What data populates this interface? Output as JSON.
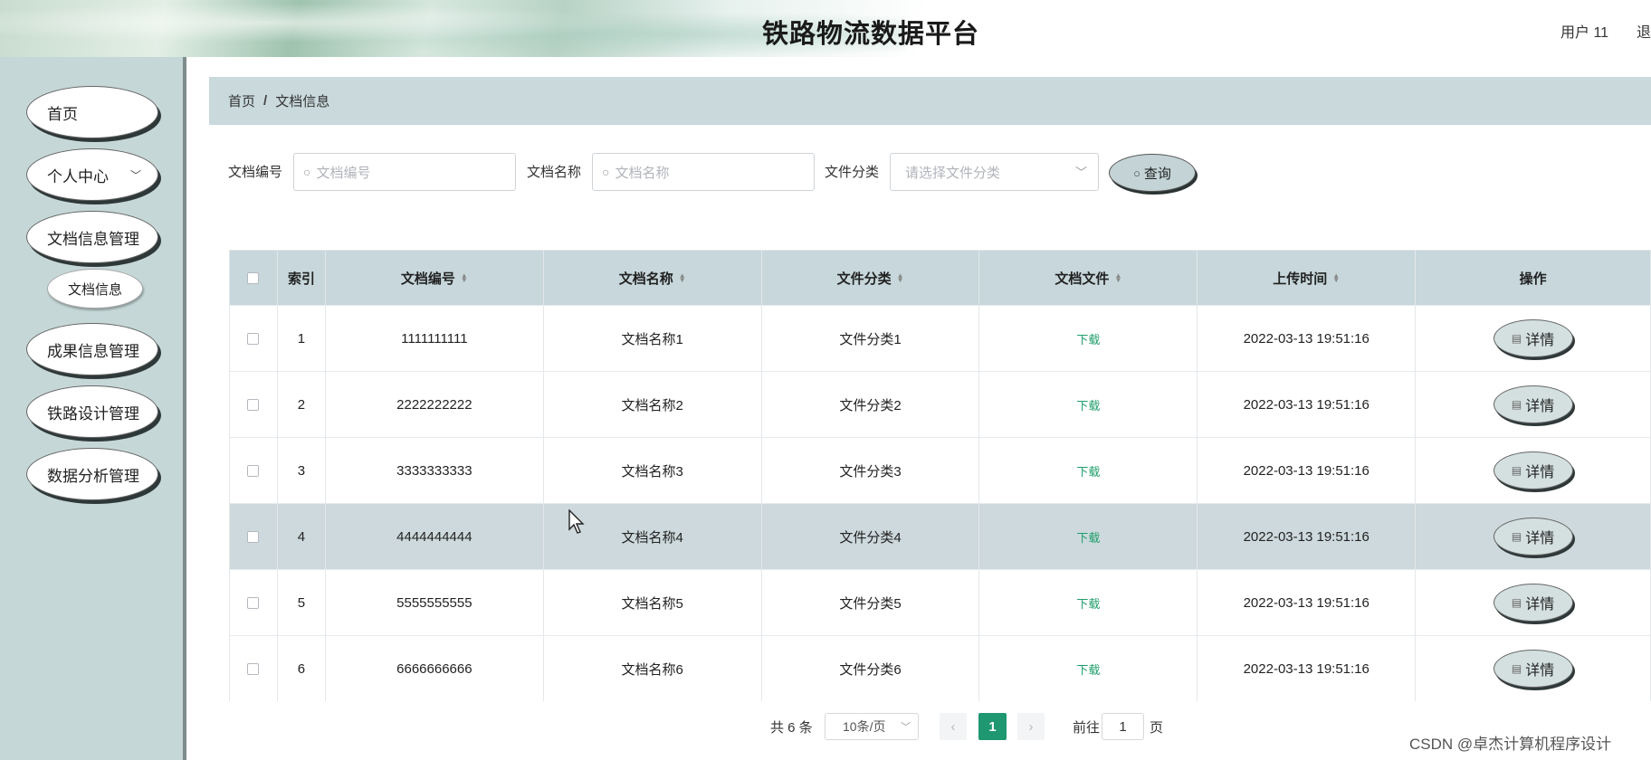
{
  "header": {
    "title": "铁路物流数据平台",
    "user": "用户 11",
    "logout": "退"
  },
  "sidebar": {
    "items": [
      {
        "label": "首页"
      },
      {
        "label": "个人中心",
        "chevron": "﹀"
      },
      {
        "label": "文档信息管理"
      },
      {
        "label": "成果信息管理"
      },
      {
        "label": "铁路设计管理"
      },
      {
        "label": "数据分析管理"
      }
    ],
    "sub_item": {
      "label": "文档信息"
    }
  },
  "breadcrumb": {
    "home": "首页",
    "sep": "/",
    "current": "文档信息"
  },
  "search": {
    "doc_no_label": "文档编号",
    "doc_no_placeholder": "文档编号",
    "doc_name_label": "文档名称",
    "doc_name_placeholder": "文档名称",
    "category_label": "文件分类",
    "category_placeholder": "请选择文件分类",
    "query_label": "查询"
  },
  "table": {
    "headers": [
      "索引",
      "文档编号",
      "文档名称",
      "文件分类",
      "文档文件",
      "上传时间",
      "操作"
    ],
    "rows": [
      {
        "index": "1",
        "doc_no": "1111111111",
        "name": "文档名称1",
        "category": "文件分类1",
        "file": "下载",
        "time": "2022-03-13 19:51:16",
        "action": "详情"
      },
      {
        "index": "2",
        "doc_no": "2222222222",
        "name": "文档名称2",
        "category": "文件分类2",
        "file": "下载",
        "time": "2022-03-13 19:51:16",
        "action": "详情"
      },
      {
        "index": "3",
        "doc_no": "3333333333",
        "name": "文档名称3",
        "category": "文件分类3",
        "file": "下载",
        "time": "2022-03-13 19:51:16",
        "action": "详情"
      },
      {
        "index": "4",
        "doc_no": "4444444444",
        "name": "文档名称4",
        "category": "文件分类4",
        "file": "下载",
        "time": "2022-03-13 19:51:16",
        "action": "详情"
      },
      {
        "index": "5",
        "doc_no": "5555555555",
        "name": "文档名称5",
        "category": "文件分类5",
        "file": "下载",
        "time": "2022-03-13 19:51:16",
        "action": "详情"
      },
      {
        "index": "6",
        "doc_no": "6666666666",
        "name": "文档名称6",
        "category": "文件分类6",
        "file": "下载",
        "time": "2022-03-13 19:51:16",
        "action": "详情"
      }
    ]
  },
  "pagination": {
    "total": "共 6 条",
    "page_size": "10条/页",
    "current_page": "1",
    "goto_prefix": "前往",
    "goto_value": "1",
    "goto_suffix": "页"
  },
  "watermark": "CSDN @卓杰计算机程序设计",
  "colors": {
    "accent": "#1f9770",
    "header_bg": "#c9d9dc"
  }
}
